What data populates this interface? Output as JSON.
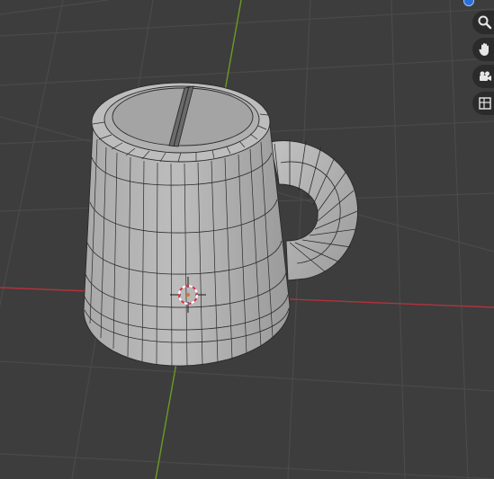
{
  "viewport": {
    "background": "#3d3d3d",
    "grid_color": "#4a4a4a",
    "x_axis_color": "#b3323c",
    "y_axis_color": "#6b9a24"
  },
  "object": {
    "name_icon": "mug-mesh",
    "face_color": "#b8b8b8",
    "edge_color": "#2a2a2a"
  },
  "cursor_3d": {
    "icon": "3d-cursor-icon"
  },
  "navigation": {
    "buttons": [
      {
        "icon": "zoom-icon"
      },
      {
        "icon": "pan-hand-icon"
      },
      {
        "icon": "camera-icon"
      },
      {
        "icon": "perspective-grid-icon"
      }
    ]
  }
}
